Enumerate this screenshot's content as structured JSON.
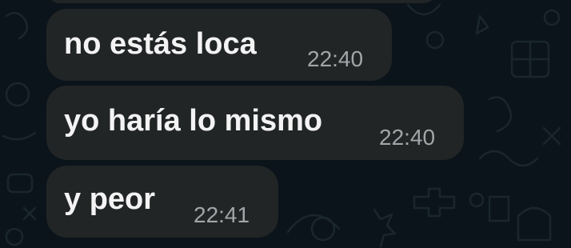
{
  "chat": {
    "background_color": "#0b141a",
    "bubble_color": "#222526",
    "messages": [
      {
        "text": "no estás loca",
        "time": "22:40"
      },
      {
        "text": "yo haría lo mismo",
        "time": "22:40"
      },
      {
        "text": "y peor",
        "time": "22:41"
      }
    ]
  }
}
